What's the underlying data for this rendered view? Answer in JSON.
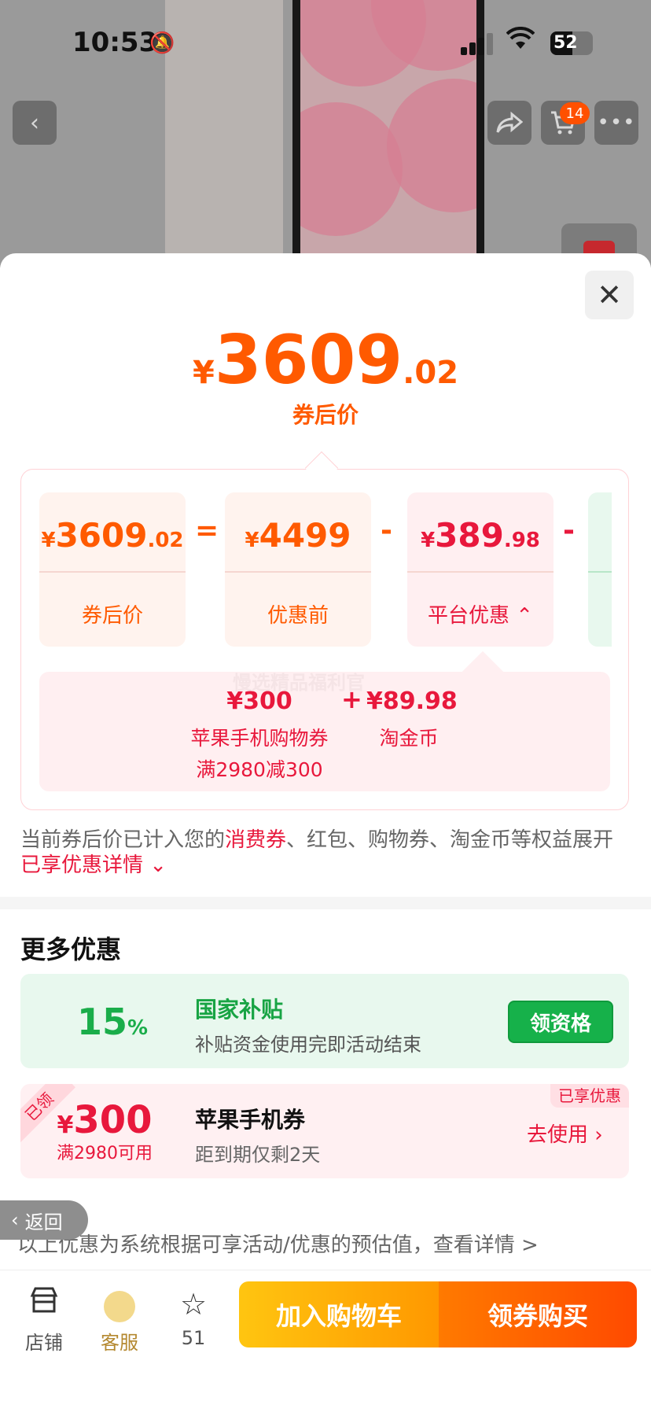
{
  "status_bar": {
    "time": "10:53",
    "battery": "52",
    "muted_icon": "bell-slash-icon"
  },
  "top_nav": {
    "back_icon": "chevron-left-icon",
    "share_icon": "share-icon",
    "cart_icon": "cart-icon",
    "cart_badge": "14",
    "more_icon": "more-icon"
  },
  "sheet": {
    "close_icon": "close-icon",
    "price": {
      "currency": "¥",
      "integer": "3609",
      "decimal": ".02",
      "label": "券后价"
    },
    "breakdown": {
      "cards": [
        {
          "currency": "¥",
          "integer": "3609",
          "decimal": ".02",
          "label": "券后价",
          "color": "#ff5a00",
          "bg": "#fff3ee"
        },
        {
          "currency": "¥",
          "integer": "4499",
          "decimal": "",
          "label": "优惠前",
          "color": "#ff5a00",
          "bg": "#fff3ee"
        },
        {
          "currency": "¥",
          "integer": "389",
          "decimal": ".98",
          "label": "平台优惠",
          "color": "#e8183c",
          "bg": "#ffeff1"
        }
      ],
      "operators": [
        "=",
        "-",
        "-"
      ],
      "platform_detail": {
        "watermark": "慢选精品福利官",
        "items": [
          {
            "amount": "¥300",
            "name": "苹果手机购物券",
            "condition": "满2980减300"
          },
          {
            "amount": "¥89.98",
            "name": "淘金币",
            "condition": ""
          }
        ],
        "plus": "+"
      }
    },
    "note": {
      "text_before": "当前券后价已计入您的",
      "highlight": "消费券",
      "text_after": "、红包、购物券、淘金币等权益展开",
      "link": "已享优惠详情"
    },
    "more": {
      "title": "更多优惠",
      "subsidy": {
        "percent": "15",
        "percent_sign": "%",
        "title": "国家补贴",
        "desc": "补贴资金使用完即活动结束",
        "button": "领资格"
      },
      "coupon": {
        "claimed_tag": "已领",
        "currency": "¥",
        "amount": "300",
        "condition": "满2980可用",
        "title": "苹果手机券",
        "expiry": "距到期仅剩2天",
        "enjoyed_tag": "已享优惠",
        "action": "去使用"
      }
    },
    "back_label": "返回",
    "disclaimer": "以上优惠为系统根据可享活动/优惠的预估值，查看详情 >"
  },
  "bottom_bar": {
    "tabs": [
      {
        "icon": "store-icon",
        "label": "店铺"
      },
      {
        "icon": "service-avatar-icon",
        "label": "客服"
      },
      {
        "icon": "star-icon",
        "label": "51"
      }
    ],
    "add_to_cart": "加入购物车",
    "buy": "领券购买"
  },
  "colors": {
    "accent_orange": "#ff5a00",
    "accent_red": "#e8183c",
    "green": "#1aad4a"
  }
}
